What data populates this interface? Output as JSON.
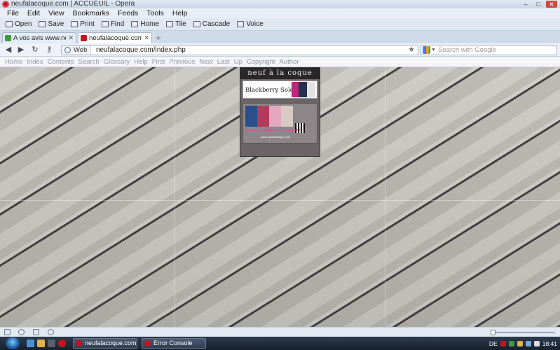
{
  "window": {
    "title": "neufalacoque.com | ACCUEUIL - Opera"
  },
  "menubar": [
    "File",
    "Edit",
    "View",
    "Bookmarks",
    "Feeds",
    "Tools",
    "Help"
  ],
  "toolbar": [
    {
      "label": "Open",
      "icon": "folder-icon"
    },
    {
      "label": "Save",
      "icon": "save-icon"
    },
    {
      "label": "Print",
      "icon": "print-icon"
    },
    {
      "label": "Find",
      "icon": "find-icon"
    },
    {
      "label": "Home",
      "icon": "home-icon"
    },
    {
      "label": "Tile",
      "icon": "tile-icon"
    },
    {
      "label": "Cascade",
      "icon": "cascade-icon"
    },
    {
      "label": "Voice",
      "icon": "voice-icon"
    }
  ],
  "tabs": [
    {
      "label": "A vos avis www.neufal...",
      "active": false
    },
    {
      "label": "neufalacoque.com | A...",
      "active": true
    }
  ],
  "address": {
    "badge": "Web",
    "url": "neufalacoque.com/index.php"
  },
  "search": {
    "placeholder": "Search with Google"
  },
  "navlinks": [
    "Home",
    "Index",
    "Contents",
    "Search",
    "Glossary",
    "Help",
    "First",
    "Previous",
    "Next",
    "Last",
    "Up",
    "Copyright",
    "Author"
  ],
  "site": {
    "header": "neuf à la coque",
    "card_text": "Blackberry Sold",
    "promo_text": "NEUFALACOQUE.COM EN MOBILE !",
    "promo_url": "www.neufalacoque.com"
  },
  "taskbar": {
    "tasks": [
      "neufalacoque.com | ...",
      "Error Console"
    ],
    "lang": "DE",
    "clock": "18:41"
  },
  "colors": {
    "accent": "#c2151d",
    "chrome": "#dfe7f1"
  }
}
